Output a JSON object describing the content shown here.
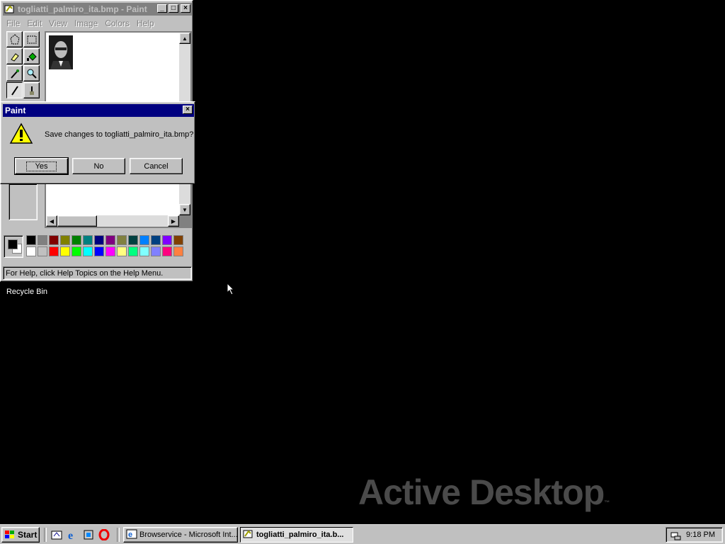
{
  "paint": {
    "title": "togliatti_palmiro_ita.bmp - Paint",
    "menu": [
      {
        "label": "File"
      },
      {
        "label": "Edit"
      },
      {
        "label": "View"
      },
      {
        "label": "Image"
      },
      {
        "label": "Colors"
      },
      {
        "label": "Help"
      }
    ],
    "status_text": "For Help, click Help Topics on the Help Menu."
  },
  "dialog": {
    "title": "Paint",
    "message": "Save changes to togliatti_palmiro_ita.bmp?",
    "buttons": {
      "yes": "Yes",
      "no": "No",
      "cancel": "Cancel"
    }
  },
  "desktop": {
    "recycle_bin_label": "Recycle Bin",
    "watermark": "Active Desktop",
    "watermark_mark": "™"
  },
  "taskbar": {
    "start_label": "Start",
    "tasks": [
      {
        "label": "Browservice - Microsoft Int..."
      },
      {
        "label": "togliatti_palmiro_ita.b..."
      }
    ],
    "clock": "9:18 PM"
  },
  "colors": {
    "palette_top": [
      "#000000",
      "#808080",
      "#800000",
      "#808000",
      "#008000",
      "#008080",
      "#000080",
      "#800080",
      "#808040",
      "#004040",
      "#0080ff",
      "#004080",
      "#8000ff",
      "#804000"
    ],
    "palette_bottom": [
      "#ffffff",
      "#c0c0c0",
      "#ff0000",
      "#ffff00",
      "#00ff00",
      "#00ffff",
      "#0000ff",
      "#ff00ff",
      "#ffff80",
      "#00ff80",
      "#80ffff",
      "#8080ff",
      "#ff0080",
      "#ff8040"
    ]
  }
}
